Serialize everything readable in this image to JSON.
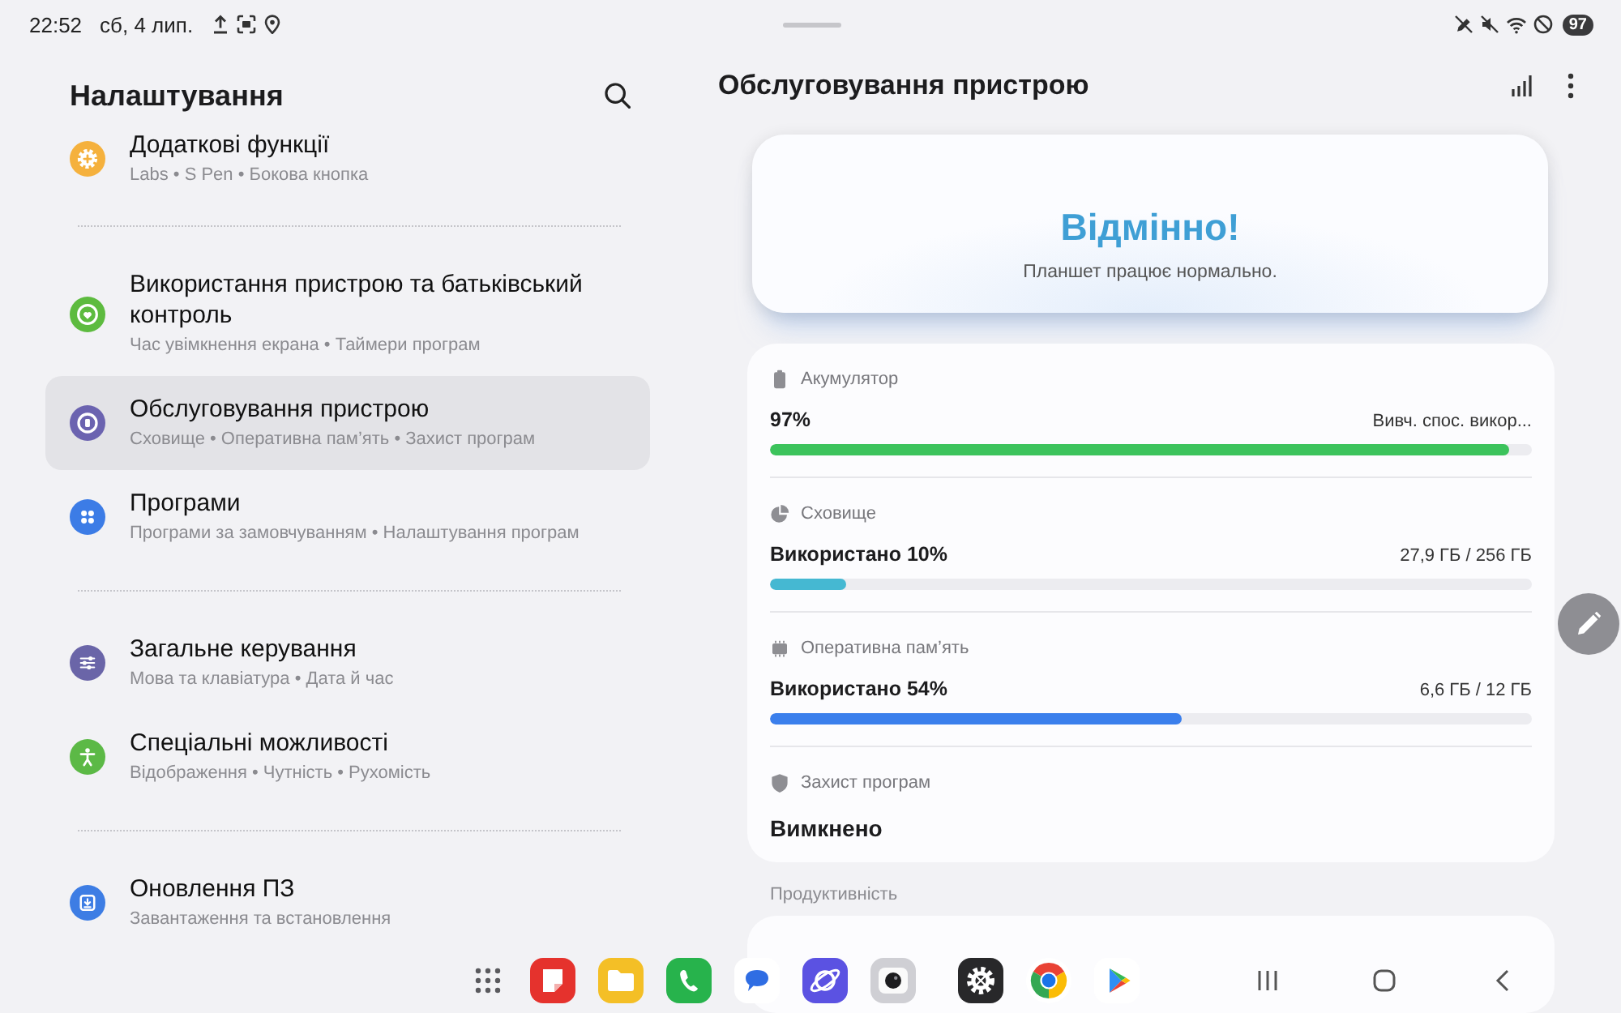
{
  "status_bar": {
    "time": "22:52",
    "date": "сб, 4 лип.",
    "battery": "97"
  },
  "settings": {
    "title": "Налаштування",
    "groups": [
      {
        "items": [
          {
            "title": "Додаткові функції",
            "subtitle": "Labs • S Pen • Бокова кнопка",
            "color": "#f5b13d",
            "selected": false
          }
        ]
      },
      {
        "items": [
          {
            "title": "Використання пристрою та батьківський контроль",
            "subtitle": "Час увімкнення екрана • Таймери програм",
            "color": "#5dbb3f",
            "selected": false
          },
          {
            "title": "Обслуговування пристрою",
            "subtitle": "Сховище • Оперативна пам’ять • Захист програм",
            "color": "#6b63b0",
            "selected": true
          },
          {
            "title": "Програми",
            "subtitle": "Програми за замовчуванням • Налаштування програм",
            "color": "#3c7ce6",
            "selected": false
          }
        ]
      },
      {
        "items": [
          {
            "title": "Загальне керування",
            "subtitle": "Мова та клавіатура • Дата й час",
            "color": "#6a65a8",
            "selected": false
          },
          {
            "title": "Спеціальні можливості",
            "subtitle": "Відображення • Чутність • Рухомість",
            "color": "#5cb946",
            "selected": false
          }
        ]
      },
      {
        "items": [
          {
            "title": "Оновлення ПЗ",
            "subtitle": "Завантаження та встановлення",
            "color": "#3d7de4",
            "selected": false
          }
        ]
      }
    ]
  },
  "device_care": {
    "title": "Обслуговування пристрою",
    "status": {
      "headline": "Відмінно!",
      "message": "Планшет працює нормально."
    },
    "stats": [
      {
        "kind": "meter",
        "label": "Акумулятор",
        "value": "97%",
        "detail": "Вивч. спос. викор...",
        "level": 0.97,
        "color": "#3cc35c"
      },
      {
        "kind": "meter",
        "label": "Сховище",
        "value": "Використано 10%",
        "detail": "27,9 ГБ / 256 ГБ",
        "level": 0.1,
        "color": "#45b8d2"
      },
      {
        "kind": "meter",
        "label": "Оперативна пам’ять",
        "value": "Використано 54%",
        "detail": "6,6 ГБ / 12 ГБ",
        "level": 0.54,
        "color": "#3b7fec"
      },
      {
        "kind": "status",
        "label": "Захист програм",
        "value": "Вимкнено"
      }
    ],
    "section_label": "Продуктивність"
  }
}
